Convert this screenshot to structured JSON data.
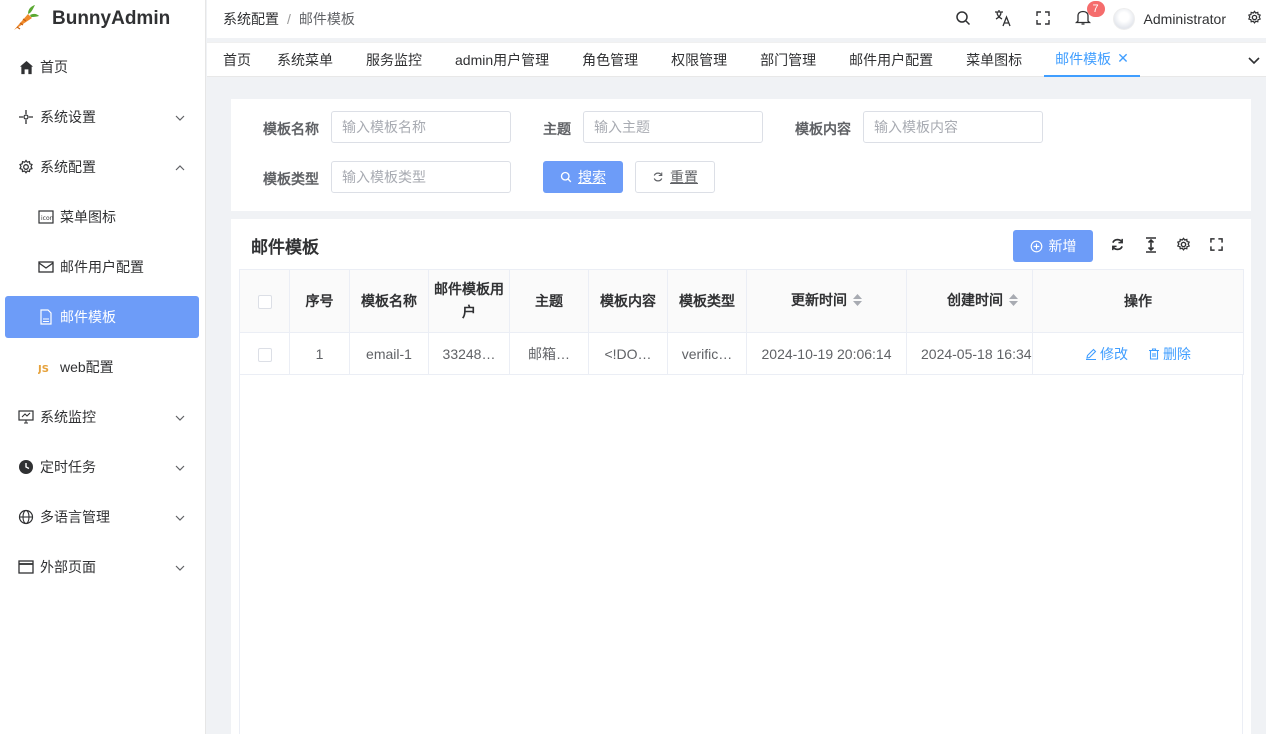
{
  "app": {
    "name": "BunnyAdmin"
  },
  "sidebar": {
    "items": [
      {
        "label": "首页",
        "icon": "home-icon"
      },
      {
        "label": "系统设置",
        "icon": "settings-dots-icon"
      },
      {
        "label": "系统配置",
        "icon": "gear-icon"
      },
      {
        "label": "菜单图标",
        "icon": "icon-badge-icon"
      },
      {
        "label": "邮件用户配置",
        "icon": "mail-icon"
      },
      {
        "label": "邮件模板",
        "icon": "document-icon"
      },
      {
        "label": "web配置",
        "icon": "js-icon"
      },
      {
        "label": "系统监控",
        "icon": "monitor-icon"
      },
      {
        "label": "定时任务",
        "icon": "clock-icon"
      },
      {
        "label": "多语言管理",
        "icon": "globe-icon"
      },
      {
        "label": "外部页面",
        "icon": "window-icon"
      }
    ]
  },
  "header": {
    "breadcrumb": [
      "系统配置",
      "邮件模板"
    ],
    "notification_count": "7",
    "username": "Administrator"
  },
  "tabs": [
    "首页",
    "系统菜单",
    "服务监控",
    "admin用户管理",
    "角色管理",
    "权限管理",
    "部门管理",
    "邮件用户配置",
    "菜单图标",
    "邮件模板"
  ],
  "search": {
    "fields": [
      {
        "label": "模板名称",
        "placeholder": "输入模板名称"
      },
      {
        "label": "主题",
        "placeholder": "输入主题"
      },
      {
        "label": "模板内容",
        "placeholder": "输入模板内容"
      },
      {
        "label": "模板类型",
        "placeholder": "输入模板类型"
      }
    ],
    "search_button": "搜索",
    "reset_button": "重置"
  },
  "table": {
    "title": "邮件模板",
    "add_button": "新增",
    "columns": [
      "序号",
      "模板名称",
      "邮件模板用户",
      "主题",
      "模板内容",
      "模板类型",
      "更新时间",
      "创建时间",
      "操作"
    ],
    "rows": [
      {
        "index": "1",
        "name": "email-1",
        "user": "33248…",
        "subject": "邮箱…",
        "content": "<!DO…",
        "type": "verific…",
        "updated": "2024-10-19 20:06:14",
        "created": "2024-05-18 16:34",
        "edit": "修改",
        "delete": "删除"
      }
    ]
  },
  "colors": {
    "primary": "#409eff",
    "active_menu": "#6d9cf8",
    "badge": "#f56c6c"
  }
}
